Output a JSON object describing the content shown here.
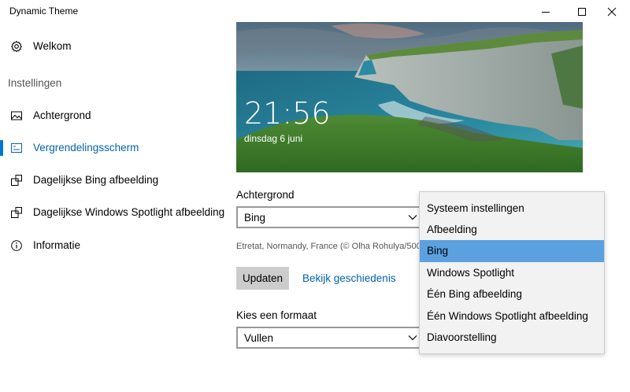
{
  "window": {
    "title": "Dynamic Theme",
    "controls": {
      "minimize": "minimize",
      "maximize": "maximize",
      "close": "close"
    }
  },
  "sidebar": {
    "welcome": {
      "label": "Welkom",
      "icon": "gear-icon"
    },
    "section_title": "Instellingen",
    "items": [
      {
        "label": "Achtergrond",
        "icon": "image-icon",
        "selected": false
      },
      {
        "label": "Vergrendelingsscherm",
        "icon": "lock-screen-icon",
        "selected": true
      },
      {
        "label": "Dagelijkse Bing afbeelding",
        "icon": "add-image-icon",
        "selected": false
      },
      {
        "label": "Dagelijkse Windows Spotlight afbeelding",
        "icon": "add-image-icon",
        "selected": false
      },
      {
        "label": "Informatie",
        "icon": "info-icon",
        "selected": false
      }
    ],
    "accent_color": "#0078d7"
  },
  "preview": {
    "time": "21:56",
    "date": "dinsdag 6 juni"
  },
  "main": {
    "background_label": "Achtergrond",
    "background_value": "Bing",
    "credit": "Etretat, Normandy, France (© Olha Rohulya/500px)",
    "update_button": "Updaten",
    "history_link": "Bekijk geschiedenis",
    "format_label": "Kies een formaat",
    "format_value": "Vullen"
  },
  "dropdown_popup": {
    "options": [
      "Systeem instellingen",
      "Afbeelding",
      "Bing",
      "Windows Spotlight",
      "Één Bing afbeelding",
      "Één Windows Spotlight afbeelding",
      "Diavoorstelling"
    ],
    "selected_index": 2,
    "highlight_color": "#5ba1e0"
  }
}
